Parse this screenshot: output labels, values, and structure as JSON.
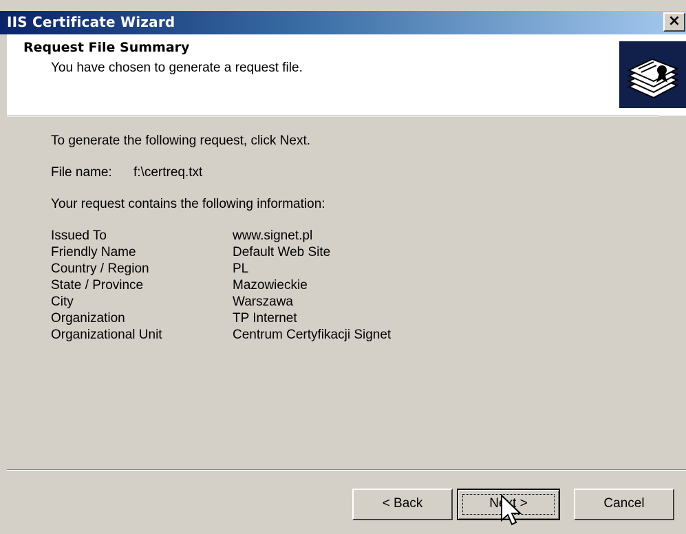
{
  "window": {
    "title": "IIS Certificate Wizard",
    "close_label": "×"
  },
  "header": {
    "title": "Request File Summary",
    "subtitle": "You have chosen to generate a request file."
  },
  "content": {
    "instruction": "To generate the following request, click Next.",
    "file_label": "File name:",
    "file_value": "f:\\certreq.txt",
    "info_intro": "Your request contains the following information:",
    "rows": [
      {
        "label": "Issued To",
        "value": "www.signet.pl"
      },
      {
        "label": "Friendly Name",
        "value": "Default Web Site"
      },
      {
        "label": "Country / Region",
        "value": "PL"
      },
      {
        "label": "State / Province",
        "value": "Mazowieckie"
      },
      {
        "label": "City",
        "value": "Warszawa"
      },
      {
        "label": "Organization",
        "value": "TP Internet"
      },
      {
        "label": "Organizational Unit",
        "value": "Centrum Certyfikacji Signet"
      }
    ]
  },
  "buttons": {
    "back": "< Back",
    "next": "Next >",
    "cancel": "Cancel"
  }
}
